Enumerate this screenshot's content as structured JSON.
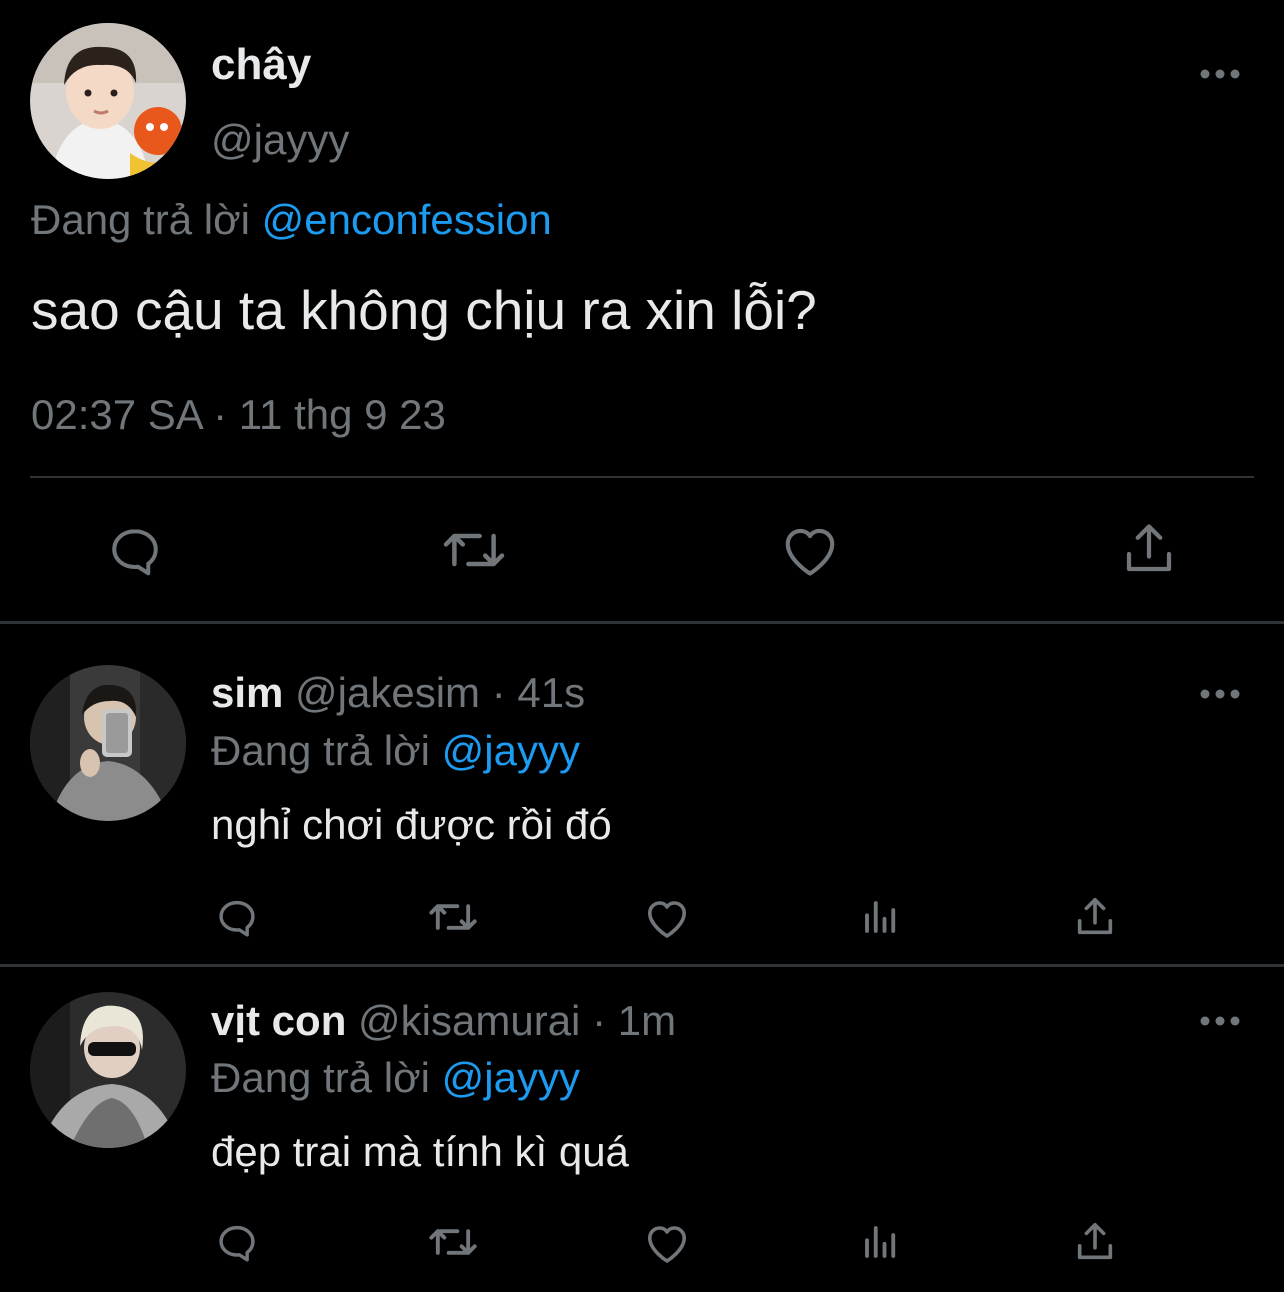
{
  "colors": {
    "background": "#000000",
    "text": "#e7e9ea",
    "muted": "#71767b",
    "accent": "#1d9bf0",
    "divider": "#2f3336"
  },
  "main_tweet": {
    "name": "chây",
    "handle": "@jayyy",
    "replying_prefix": "Đang trả lời",
    "replying_to": "@enconfession",
    "text": "sao cậu ta không chịu ra xin lỗi?",
    "timestamp": "02:37 SA · 11 thg 9 23",
    "more_icon": "more-horizontal-icon",
    "actions": [
      "reply-icon",
      "retweet-icon",
      "like-icon",
      "share-icon"
    ]
  },
  "replies": [
    {
      "name": "sim",
      "handle": "@jakesim",
      "separator": "·",
      "time": "41s",
      "replying_prefix": "Đang trả lời",
      "replying_to": "@jayyy",
      "text": "nghỉ chơi được rồi đó",
      "actions": [
        "reply-icon",
        "retweet-icon",
        "like-icon",
        "views-icon",
        "share-icon"
      ]
    },
    {
      "name": "vịt con",
      "handle": "@kisamurai",
      "separator": "·",
      "time": "1m",
      "replying_prefix": "Đang trả lời",
      "replying_to": "@jayyy",
      "text": "đẹp trai mà tính kì quá",
      "actions": [
        "reply-icon",
        "retweet-icon",
        "like-icon",
        "views-icon",
        "share-icon"
      ]
    }
  ]
}
